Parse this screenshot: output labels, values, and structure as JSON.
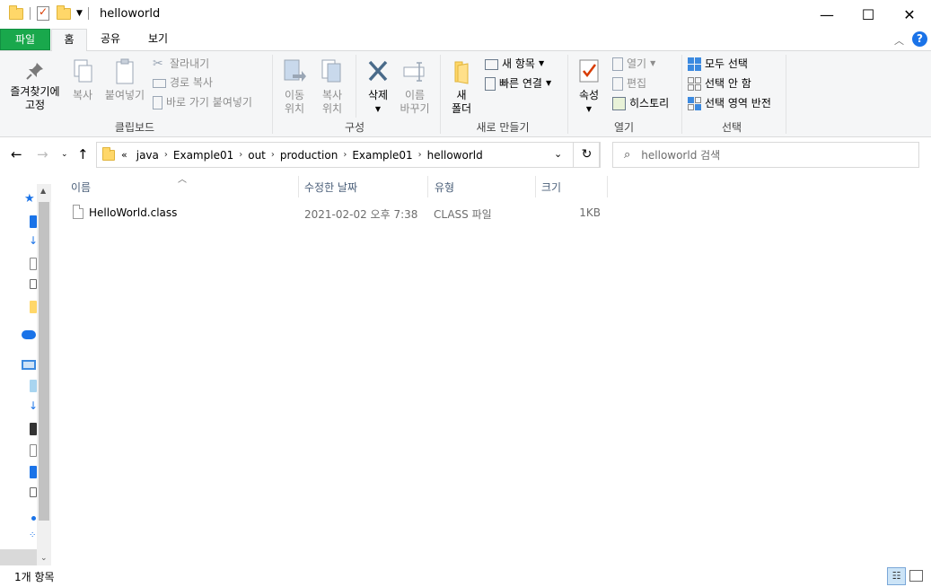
{
  "window": {
    "title": "helloworld",
    "minimize_glyph": "—",
    "maximize_glyph": "☐",
    "close_glyph": "✕"
  },
  "tabs": [
    {
      "label": "파일"
    },
    {
      "label": "홈"
    },
    {
      "label": "공유"
    },
    {
      "label": "보기"
    }
  ],
  "ribbon": {
    "clipboard": {
      "pin_line1": "즐겨찾기에",
      "pin_line2": "고정",
      "copy": "복사",
      "paste": "붙여넣기",
      "cut": "잘라내기",
      "copy_path": "경로 복사",
      "paste_shortcut": "바로 가기 붙여넣기",
      "group": "클립보드"
    },
    "organize": {
      "move_line1": "이동",
      "move_line2": "위치",
      "copyto_line1": "복사",
      "copyto_line2": "위치",
      "delete": "삭제",
      "rename_line1": "이름",
      "rename_line2": "바꾸기",
      "group": "구성"
    },
    "new": {
      "folder_line1": "새",
      "folder_line2": "폴더",
      "new_item": "새 항목",
      "easy_access": "빠른 연결",
      "group": "새로 만들기"
    },
    "open": {
      "properties": "속성",
      "open": "열기",
      "edit": "편집",
      "history": "히스토리",
      "group": "열기"
    },
    "select": {
      "select_all": "모두 선택",
      "select_none": "선택 안 함",
      "invert": "선택 영역 반전",
      "group": "선택"
    }
  },
  "address": {
    "overflow": "«",
    "crumbs": [
      "java",
      "Example01",
      "out",
      "production",
      "Example01",
      "helloworld"
    ],
    "search_placeholder": "helloworld 검색"
  },
  "columns": {
    "name": "이름",
    "date": "수정한 날짜",
    "type": "유형",
    "size": "크기"
  },
  "files": [
    {
      "name": "HelloWorld.class",
      "date": "2021-02-02 오후 7:38",
      "type": "CLASS 파일",
      "size": "1KB"
    }
  ],
  "status": {
    "item_count": "1개 항목"
  },
  "colors": {
    "file_tab": "#19a84c",
    "ribbon_bg": "#f5f6f7",
    "folder": "#ffd769",
    "accent_blue": "#1a73e8"
  }
}
